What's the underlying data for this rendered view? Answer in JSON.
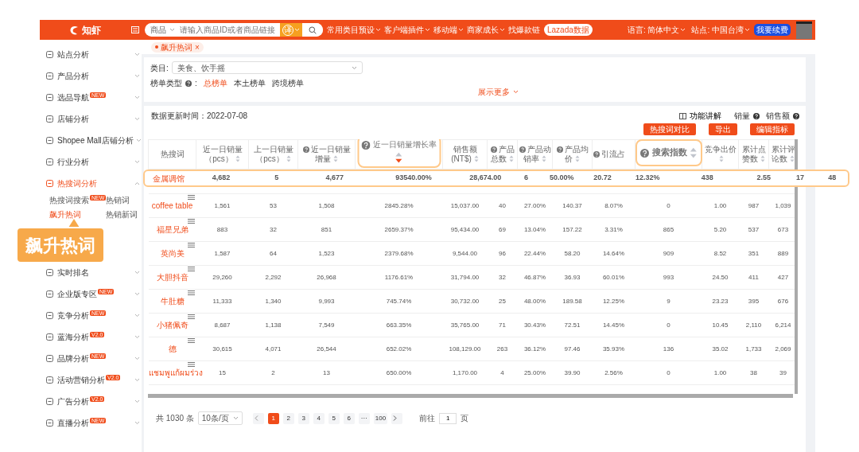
{
  "header": {
    "logo": "知虾",
    "search_scope": "商品",
    "search_placeholder": "请输入商品ID或者商品链接",
    "translate_button": "译",
    "nav": [
      {
        "label": "常用类目预设",
        "dropdown": true
      },
      {
        "label": "客户端插件",
        "dropdown": true
      },
      {
        "label": "移动端",
        "dropdown": true
      },
      {
        "label": "商家成长",
        "dropdown": true
      },
      {
        "label": "找爆款链",
        "dropdown": false
      }
    ],
    "lazada_button": "Lazada数据",
    "language": "语言: 简体中文",
    "site": "站点: 中国台湾",
    "renew_button": "我要续费"
  },
  "tags": [
    {
      "label": "飙升热词",
      "close": "×",
      "selected": true
    }
  ],
  "sidebar": {
    "items": [
      {
        "label": "站点分析",
        "expanded": false,
        "selected": false
      },
      {
        "label": "产品分析",
        "expanded": false,
        "selected": false
      },
      {
        "label": "选品导航",
        "badge": "NEW",
        "expanded": false,
        "selected": false
      },
      {
        "label": "店铺分析",
        "expanded": false,
        "selected": false
      },
      {
        "label": "Shopee Mall店铺分析",
        "expanded": false,
        "selected": false
      },
      {
        "label": "行业分析",
        "expanded": false,
        "selected": false
      },
      {
        "label": "热搜词分析",
        "expanded": true,
        "selected": true,
        "children": [
          {
            "label": "热搜词搜索",
            "badge": "NEW",
            "selected": false
          },
          {
            "label": "热销词",
            "selected": false
          },
          {
            "label": "飙升热词",
            "selected": true
          },
          {
            "label": "热销新词",
            "selected": false
          }
        ]
      },
      {
        "label": "实时排名",
        "expanded": false,
        "selected": false
      },
      {
        "label": "企业版专区",
        "badge": "NEW",
        "expanded": false,
        "selected": false
      },
      {
        "label": "竞争分析",
        "badge": "NEW",
        "expanded": false,
        "selected": false
      },
      {
        "label": "蓝海分析",
        "badge": "V2.0",
        "expanded": false,
        "selected": false
      },
      {
        "label": "品牌分析",
        "badge": "NEW",
        "expanded": false,
        "selected": false
      },
      {
        "label": "活动营销分析",
        "badge": "V2.0",
        "expanded": false,
        "selected": false
      },
      {
        "label": "广告分析",
        "badge": "V2.0",
        "expanded": false,
        "selected": false
      },
      {
        "label": "直播分析",
        "badge": "NEW",
        "expanded": false,
        "selected": false
      }
    ]
  },
  "callout": {
    "label": "飙升热词"
  },
  "filters": {
    "category_label": "类目:",
    "category_value": "美食、饮手摇",
    "rank_type_label": "榜单类型",
    "rank_type_suffix": ":",
    "rank_types": [
      {
        "label": "总榜单",
        "selected": true
      },
      {
        "label": "本土榜单",
        "selected": false
      },
      {
        "label": "跨境榜单",
        "selected": false
      }
    ],
    "show_more": "展示更多"
  },
  "table_panel": {
    "updated": "数据更新时间：2022-07-08",
    "guide": "功能讲解",
    "toggles": [
      {
        "label": "销量"
      },
      {
        "label": "销售额"
      }
    ],
    "buttons": [
      "热搜词对比",
      "导出",
      "编辑指标"
    ],
    "columns": [
      {
        "label": "热搜词"
      },
      {
        "label": "近一日销量（pcs）",
        "sorted": false
      },
      {
        "label": "上一日销量（pcs）",
        "sorted": false
      },
      {
        "label": "近一日销量增量",
        "help": true,
        "sorted": false
      },
      {
        "label": "近一日销量增长率",
        "help": true,
        "sorted": true,
        "callout": true
      },
      {
        "label": "销售额(NT$)",
        "sorted": false
      },
      {
        "label": "产品总数",
        "help": true,
        "sorted": false
      },
      {
        "label": "产品动销率",
        "help": true,
        "sorted": false
      },
      {
        "label": "产品均价",
        "help": true,
        "sorted": false
      },
      {
        "label": "引流占",
        "help": true
      },
      {
        "label": "搜索指数",
        "help": true,
        "sorted": false,
        "callout": true
      },
      {
        "label": "竞争出价",
        "sorted": false
      },
      {
        "label": "累计点赞数",
        "sorted": false
      },
      {
        "label": "累计评论数",
        "sorted": false
      }
    ],
    "highlight_row": [
      "金属调馆",
      "4,682",
      "5",
      "4,677",
      "93540.00%",
      "28,674.00",
      "6",
      "50.00%",
      "20.72",
      "12.32%",
      "438",
      "2.55",
      "17",
      "48"
    ],
    "rows": [
      [
        "coffee table",
        "1,561",
        "53",
        "1,508",
        "2845.28%",
        "15,037.00",
        "40",
        "27.00%",
        "140.37",
        "8.07%",
        "0",
        "1.00",
        "987",
        "1,039"
      ],
      [
        "福星兄弟",
        "883",
        "32",
        "851",
        "2659.37%",
        "95,434.00",
        "69",
        "13.04%",
        "157.22",
        "3.31%",
        "865",
        "5.20",
        "537",
        "673"
      ],
      [
        "英尚美",
        "1,587",
        "64",
        "1,523",
        "2379.68%",
        "9,544.00",
        "96",
        "22.44%",
        "58.20",
        "14.64%",
        "909",
        "8.52",
        "351",
        "889"
      ],
      [
        "大胆抖音",
        "29,260",
        "2,292",
        "26,968",
        "1176.61%",
        "31,794.00",
        "32",
        "46.87%",
        "36.93",
        "60.01%",
        "993",
        "24.50",
        "411",
        "427"
      ],
      [
        "牛肚糖",
        "11,333",
        "1,340",
        "9,993",
        "745.74%",
        "30,732.00",
        "25",
        "48.00%",
        "189.58",
        "12.25%",
        "9",
        "23.23",
        "395",
        "676"
      ],
      [
        "小猪佩奇",
        "8,687",
        "1,138",
        "7,549",
        "663.35%",
        "35,765.00",
        "71",
        "30.43%",
        "72.51",
        "14.45%",
        "0",
        "10.45",
        "2,110",
        "6,214"
      ],
      [
        "德",
        "30,615",
        "4,071",
        "26,544",
        "652.02%",
        "108,129.00",
        "263",
        "36.12%",
        "97.46",
        "35.93%",
        "136",
        "35.02",
        "1,733",
        "2,069"
      ],
      [
        "แชมพูแก้ผมร่วง",
        "15",
        "2",
        "13",
        "650.00%",
        "1,170.00",
        "4",
        "25.00%",
        "39.90",
        "2.56%",
        "0",
        "1.00",
        "38",
        "39"
      ]
    ],
    "pagination": {
      "total": "共 1030 条",
      "page_size": "10条/页",
      "pages": [
        {
          "label": "1",
          "selected": true
        },
        {
          "label": "2",
          "selected": false
        },
        {
          "label": "3",
          "selected": false
        },
        {
          "label": "4",
          "selected": false
        },
        {
          "label": "5",
          "selected": false
        },
        {
          "label": "6",
          "selected": false
        },
        {
          "label": "···",
          "selected": false
        },
        {
          "label": "100",
          "selected": false
        }
      ],
      "goto_label": "前往",
      "goto_value": "1",
      "goto_suffix": "页"
    }
  }
}
